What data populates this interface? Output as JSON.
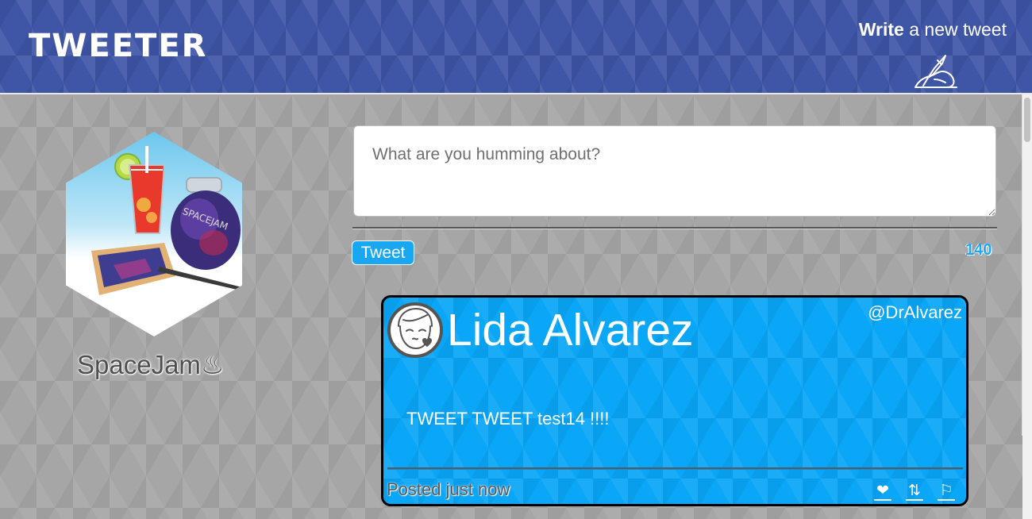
{
  "nav": {
    "brand": "TWEETER",
    "compose_bold": "Write",
    "compose_rest": " a new tweet"
  },
  "profile": {
    "name": "SpaceJam♨",
    "avatar_icon": "spacejam-jar-avatar"
  },
  "composer": {
    "placeholder": "What are you humming about?",
    "value": "",
    "button_label": "Tweet",
    "counter": "140"
  },
  "tweets": [
    {
      "author": "Lida Alvarez",
      "handle": "@DrAlvarez",
      "text": "TWEET TWEET test14 !!!!",
      "time": "Posted just now",
      "actions": [
        {
          "icon": "heart-icon",
          "glyph": "❤"
        },
        {
          "icon": "retweet-icon",
          "glyph": "⇅"
        },
        {
          "icon": "flag-icon",
          "glyph": "⚐"
        }
      ]
    }
  ],
  "colors": {
    "navbar": "#3f55a6",
    "tweet_card": "#0aa6f8",
    "accent": "#18a7f0"
  }
}
